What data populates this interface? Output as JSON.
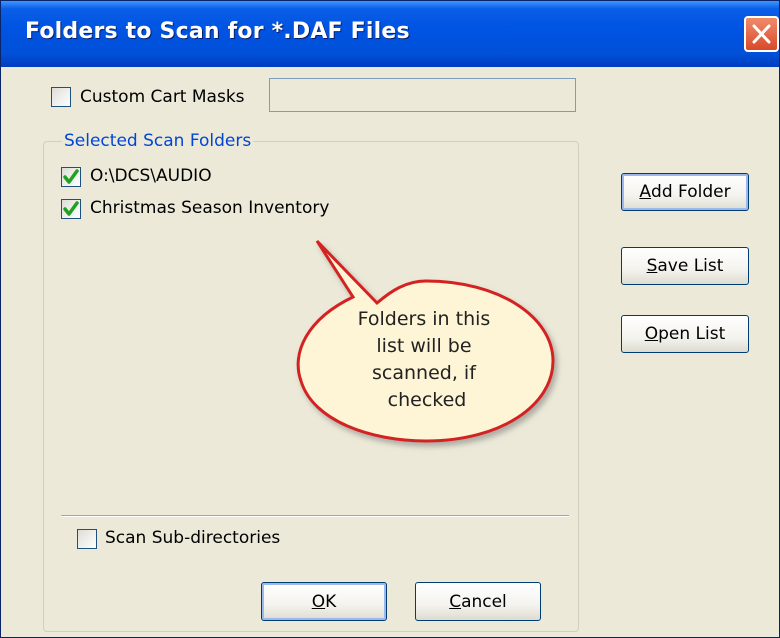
{
  "window": {
    "title": "Folders to Scan for *.DAF Files"
  },
  "custom_cart_masks": {
    "label": "Custom Cart Masks",
    "checked": false,
    "value": ""
  },
  "group": {
    "legend": "Selected Scan Folders",
    "folders": [
      {
        "label": "O:\\DCS\\AUDIO",
        "checked": true
      },
      {
        "label": "Christmas Season Inventory",
        "checked": true
      }
    ]
  },
  "scan_subdirectories": {
    "label": "Scan Sub-directories",
    "checked": false
  },
  "buttons": {
    "add_folder": {
      "mnemonic": "A",
      "rest": "dd Folder"
    },
    "save_list": {
      "mnemonic": "S",
      "rest": "ave List"
    },
    "open_list": {
      "mnemonic": "O",
      "rest": "pen List"
    },
    "ok": {
      "mnemonic": "O",
      "rest": "K"
    },
    "cancel": {
      "mnemonic": "C",
      "rest": "ancel"
    }
  },
  "callout": {
    "lines": [
      "Folders in this",
      "list will be",
      "scanned, if",
      "checked"
    ]
  },
  "colors": {
    "titlebar": "#0054e3",
    "group_legend": "#0046d5",
    "check_mark": "#21a121",
    "callout_fill": "#fdf5d6",
    "callout_border": "#d42020"
  }
}
